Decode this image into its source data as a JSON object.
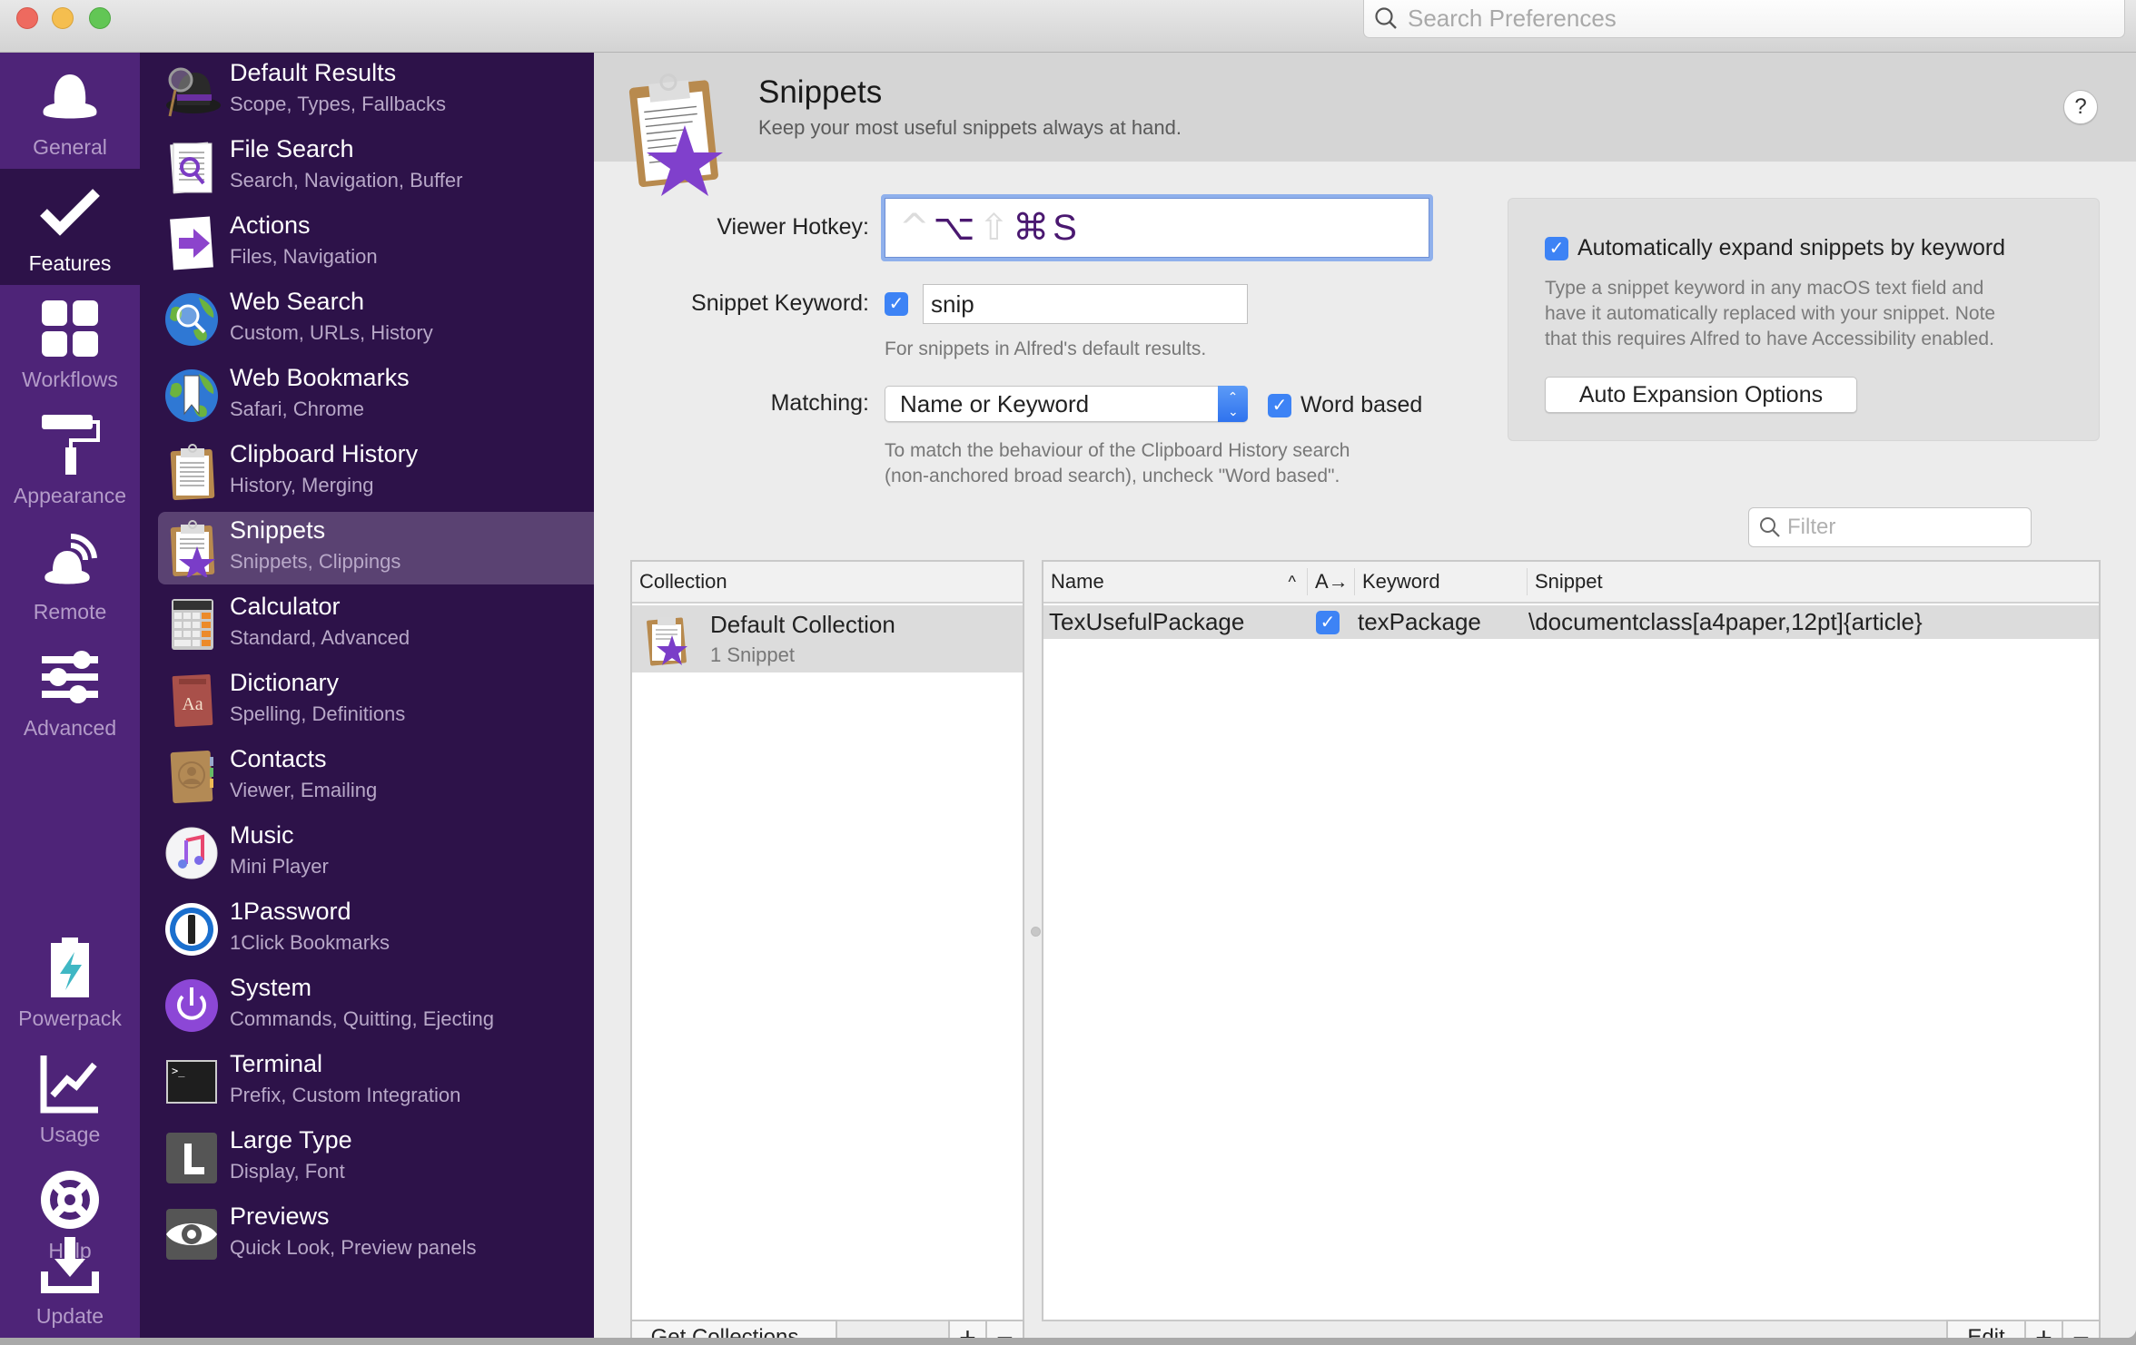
{
  "titlebar": {
    "search_placeholder": "Search Preferences"
  },
  "nav": {
    "items": [
      {
        "label": "General",
        "icon": "alfred-hat-icon",
        "selected": false
      },
      {
        "label": "Features",
        "icon": "checkmark-icon",
        "selected": true
      },
      {
        "label": "Workflows",
        "icon": "workflows-grid-icon",
        "selected": false
      },
      {
        "label": "Appearance",
        "icon": "paint-roller-icon",
        "selected": false
      },
      {
        "label": "Remote",
        "icon": "remote-signal-icon",
        "selected": false
      },
      {
        "label": "Advanced",
        "icon": "sliders-icon",
        "selected": false
      },
      {
        "label": "Powerpack",
        "icon": "battery-bolt-icon",
        "selected": false
      },
      {
        "label": "Usage",
        "icon": "usage-chart-icon",
        "selected": false
      },
      {
        "label": "Help",
        "icon": "lifebuoy-icon",
        "selected": false
      },
      {
        "label": "Update",
        "icon": "download-icon",
        "selected": false
      }
    ]
  },
  "features": {
    "items": [
      {
        "title": "Default Results",
        "subtitle": "Scope, Types, Fallbacks",
        "icon": "alfred-hat-magnifier-icon"
      },
      {
        "title": "File Search",
        "subtitle": "Search, Navigation, Buffer",
        "icon": "file-search-icon"
      },
      {
        "title": "Actions",
        "subtitle": "Files, Navigation",
        "icon": "actions-arrow-icon"
      },
      {
        "title": "Web Search",
        "subtitle": "Custom, URLs, History",
        "icon": "globe-search-icon"
      },
      {
        "title": "Web Bookmarks",
        "subtitle": "Safari, Chrome",
        "icon": "globe-bookmark-icon"
      },
      {
        "title": "Clipboard History",
        "subtitle": "History, Merging",
        "icon": "clipboard-icon"
      },
      {
        "title": "Snippets",
        "subtitle": "Snippets, Clippings",
        "icon": "clipboard-star-icon",
        "selected": true
      },
      {
        "title": "Calculator",
        "subtitle": "Standard, Advanced",
        "icon": "calculator-icon"
      },
      {
        "title": "Dictionary",
        "subtitle": "Spelling, Definitions",
        "icon": "dictionary-icon"
      },
      {
        "title": "Contacts",
        "subtitle": "Viewer, Emailing",
        "icon": "contacts-icon"
      },
      {
        "title": "Music",
        "subtitle": "Mini Player",
        "icon": "music-note-icon"
      },
      {
        "title": "1Password",
        "subtitle": "1Click Bookmarks",
        "icon": "1password-icon"
      },
      {
        "title": "System",
        "subtitle": "Commands, Quitting, Ejecting",
        "icon": "power-icon"
      },
      {
        "title": "Terminal",
        "subtitle": "Prefix, Custom Integration",
        "icon": "terminal-icon"
      },
      {
        "title": "Large Type",
        "subtitle": "Display, Font",
        "icon": "large-type-icon"
      },
      {
        "title": "Previews",
        "subtitle": "Quick Look, Preview panels",
        "icon": "eye-icon"
      }
    ]
  },
  "header": {
    "title": "Snippets",
    "subtitle": "Keep your most useful snippets always at hand.",
    "help_label": "?"
  },
  "settings": {
    "viewer_hotkey_label": "Viewer Hotkey:",
    "hotkey_keys": [
      {
        "glyph": "^",
        "active": false,
        "name": "control"
      },
      {
        "glyph": "⌥",
        "active": true,
        "name": "option"
      },
      {
        "glyph": "⇧",
        "active": false,
        "name": "shift"
      },
      {
        "glyph": "⌘",
        "active": true,
        "name": "command"
      },
      {
        "glyph": "S",
        "active": true,
        "name": "key"
      }
    ],
    "snippet_keyword_label": "Snippet Keyword:",
    "snippet_keyword_enabled": true,
    "snippet_keyword_value": "snip",
    "snippet_keyword_hint": "For snippets in Alfred's default results.",
    "matching_label": "Matching:",
    "matching_value": "Name or Keyword",
    "word_based_checked": true,
    "word_based_label": "Word based",
    "matching_hint_1": "To match the behaviour of the Clipboard History search",
    "matching_hint_2": "(non-anchored broad search), uncheck \"Word based\"."
  },
  "auto_expand": {
    "checked": true,
    "label": "Automatically expand snippets by keyword",
    "hint_1": "Type a snippet keyword in any macOS text field and",
    "hint_2": "have it automatically replaced with your snippet. Note",
    "hint_3": "that this requires Alfred to have Accessibility enabled.",
    "button_label": "Auto Expansion Options"
  },
  "filter": {
    "placeholder": "Filter",
    "value": ""
  },
  "collections": {
    "header": "Collection",
    "rows": [
      {
        "name": "Default Collection",
        "count": "1 Snippet",
        "selected": true
      }
    ],
    "get_button": "Get Collections...",
    "add_label": "+",
    "remove_label": "−"
  },
  "snippets_table": {
    "columns": [
      "Name",
      "A→",
      "Keyword",
      "Snippet"
    ],
    "sort_indicator": "^",
    "rows": [
      {
        "name": "TexUsefulPackage",
        "auto_expand": true,
        "keyword": "texPackage",
        "snippet": "\\documentclass[a4paper,12pt]{article}",
        "selected": true
      }
    ],
    "edit_label": "Edit",
    "add_label": "+",
    "remove_label": "−"
  },
  "colors": {
    "nav_bg": "#4e2478",
    "list_bg": "#2d1249",
    "selected_row": "#5a4272",
    "accent_blue": "#3d83f5",
    "hotkey_active": "#4a1870"
  }
}
